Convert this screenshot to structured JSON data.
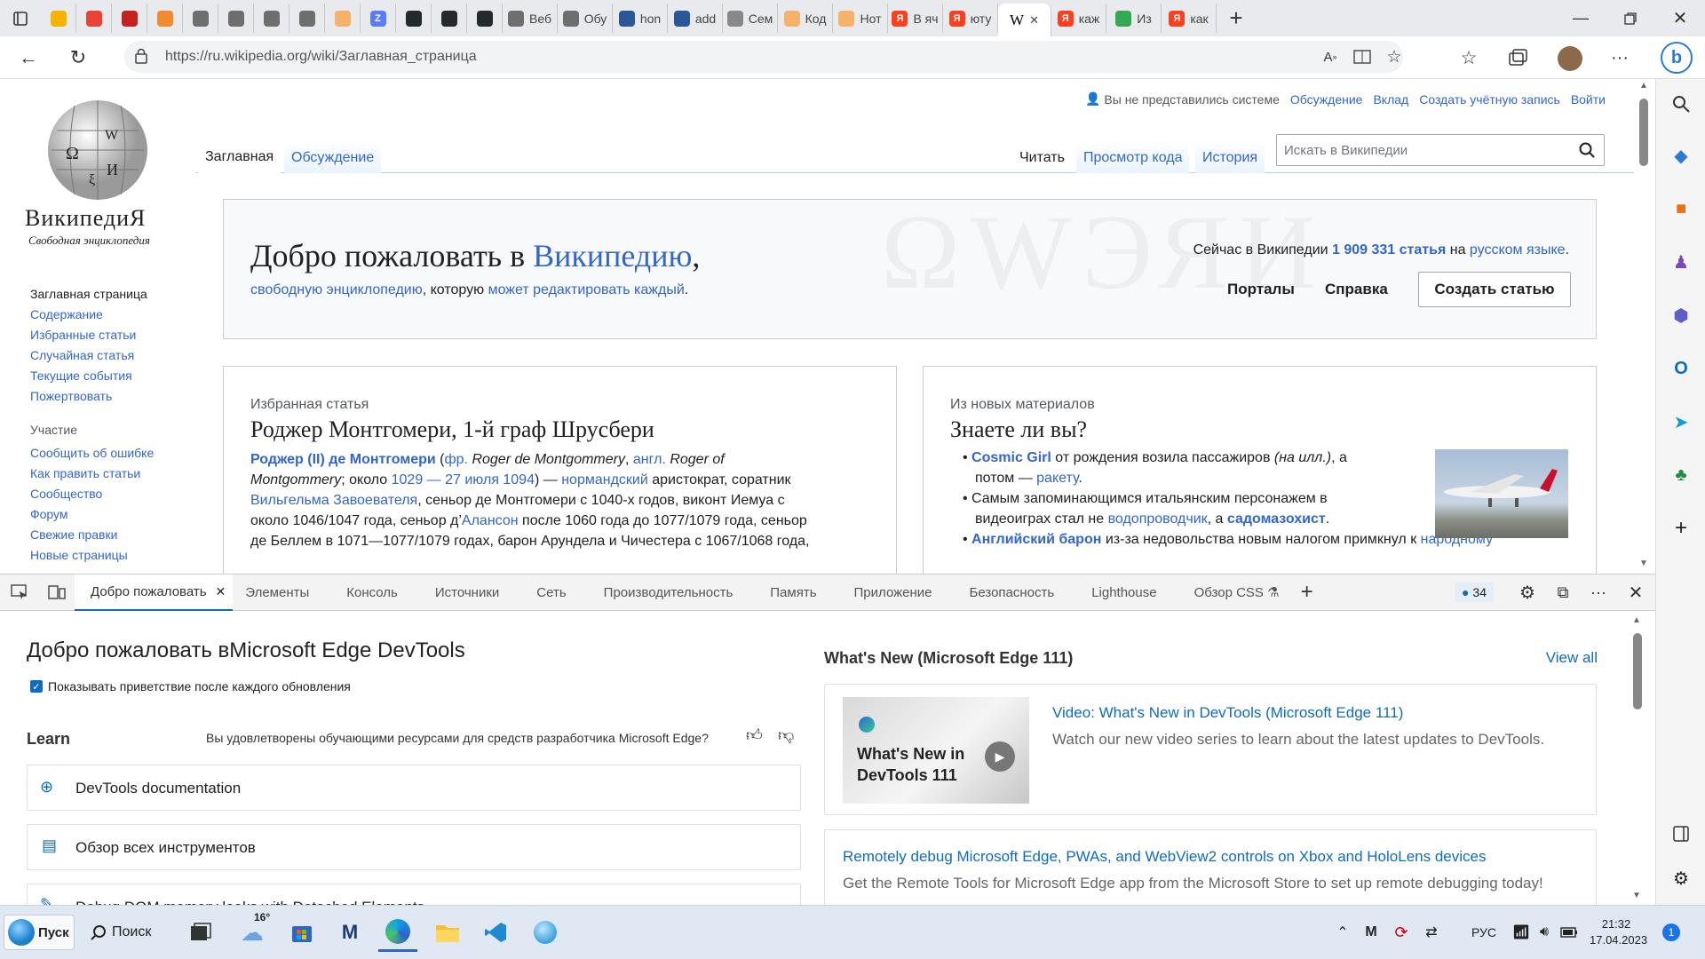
{
  "browser": {
    "tabs": [
      {
        "label": "",
        "icon": "copilot-icon",
        "color": "#f4b400"
      },
      {
        "label": "",
        "icon": "gmail-icon",
        "color": "#ea4335"
      },
      {
        "label": "",
        "icon": "gmail-icon",
        "color": "#c5221f"
      },
      {
        "label": "",
        "icon": "app-icon",
        "color": "#f28b30"
      },
      {
        "label": "",
        "icon": "chatgpt-icon",
        "color": "#6e6e6e"
      },
      {
        "label": "",
        "icon": "chatgpt-icon",
        "color": "#6e6e6e"
      },
      {
        "label": "",
        "icon": "chatgpt-icon",
        "color": "#6e6e6e"
      },
      {
        "label": "",
        "icon": "chatgpt-icon",
        "color": "#6e6e6e"
      },
      {
        "label": "",
        "icon": "link-icon",
        "color": "#f6b26b"
      },
      {
        "label": "",
        "icon": "z-icon",
        "color": "#5b7cfa"
      },
      {
        "label": "",
        "icon": "github-icon",
        "color": "#24292e"
      },
      {
        "label": "",
        "icon": "github-icon",
        "color": "#24292e"
      },
      {
        "label": "",
        "icon": "github-icon",
        "color": "#24292e"
      },
      {
        "label": "Веб",
        "icon": "chatgpt-icon",
        "color": "#6e6e6e"
      },
      {
        "label": "Обу",
        "icon": "chatgpt-icon",
        "color": "#6e6e6e"
      },
      {
        "label": "hon",
        "icon": "doc-icon",
        "color": "#2b579a"
      },
      {
        "label": "add",
        "icon": "doc-icon",
        "color": "#2b579a"
      },
      {
        "label": "Сем",
        "icon": "page-icon",
        "color": "#888888"
      },
      {
        "label": "Код",
        "icon": "link-icon",
        "color": "#f6b26b"
      },
      {
        "label": "Нот",
        "icon": "link-icon",
        "color": "#f6b26b"
      },
      {
        "label": "В яч",
        "icon": "yandex-icon",
        "color": "#fc3f1d"
      },
      {
        "label": "юту",
        "icon": "yandex-icon",
        "color": "#fc3f1d"
      },
      {
        "label": "W",
        "icon": "wikipedia-icon",
        "color": "#ffffff",
        "active": true
      },
      {
        "label": "каж",
        "icon": "yandex-icon",
        "color": "#fc3f1d"
      },
      {
        "label": "Из ",
        "icon": "bookmark-icon",
        "color": "#34a853"
      },
      {
        "label": "как",
        "icon": "yandex-icon",
        "color": "#fc3f1d"
      }
    ],
    "url": "https://ru.wikipedia.org/wiki/Заглавная_страница"
  },
  "wiki": {
    "logo_title": "ВикипедиЯ",
    "logo_subtitle": "Свободная энциклопедия",
    "nav": [
      "Заглавная страница",
      "Содержание",
      "Избранные статьи",
      "Случайная статья",
      "Текущие события",
      "Пожертвовать"
    ],
    "participation_heading": "Участие",
    "participation": [
      "Сообщить об ошибке",
      "Как править статьи",
      "Сообщество",
      "Форум",
      "Свежие правки",
      "Новые страницы"
    ],
    "personal": {
      "not_logged": "Вы не представились системе",
      "talk": "Обсуждение",
      "contrib": "Вклад",
      "create_account": "Создать учётную запись",
      "login": "Войти"
    },
    "tabs": {
      "main": "Заглавная",
      "discussion": "Обсуждение",
      "read": "Читать",
      "view_source": "Просмотр кода",
      "history": "История"
    },
    "search_placeholder": "Искать в Википедии",
    "welcome": {
      "prefix": "Добро пожаловать в ",
      "link": "Википедию",
      "suffix": ",",
      "line2_a": "свободную энциклопедию",
      "line2_b": ", которую ",
      "line2_c": "может редактировать каждый",
      "line2_d": ".",
      "stats_a": "Сейчас в Википедии ",
      "stats_count": "1 909 331 статья",
      "stats_b": " на ",
      "stats_lang": "русском языке",
      "stats_c": ".",
      "portals": "Порталы",
      "help": "Справка",
      "create": "Создать статью"
    },
    "featured": {
      "label": "Избранная статья",
      "title": "Роджер Монтгомери, 1-й граф Шрусбери",
      "l1_bold": "Роджер (II) де Монтгомери",
      "l1_a": " (",
      "l1_fr": "фр.",
      "l1_b": " ",
      "l1_fr_name": "Roger de Montgommery",
      "l1_c": ", ",
      "l1_en": "англ.",
      "l1_d": " ",
      "l1_en_name": "Roger of",
      "l2_en_name": "Montgommery",
      "l2_a": "; около ",
      "l2_y1": "1029",
      "l2_dash": " — ",
      "l2_y2": "27 июля 1094",
      "l2_b": ") — ",
      "l2_norm": "нормандский",
      "l2_c": " аристократ, соратник",
      "l3_link": "Вильгельма Завоевателя",
      "l3_rest": ", сеньор де Монтгомери с 1040-х годов, виконт Иемуа с",
      "l4_a": "около 1046/1047 года, сеньор д’",
      "l4_link": "Алансон",
      "l4_b": " после 1060 года до 1077/1079 года, сеньор",
      "l5": "де Беллем в 1071—1077/1079 годах, барон Арундела и Чичестера с 1067/1068 года,"
    },
    "dyk": {
      "label": "Из новых материалов",
      "title": "Знаете ли вы?",
      "i1_link": "Cosmic Girl",
      "i1_a": " от рождения возила пассажиров ",
      "i1_it": "(на илл.)",
      "i1_b": ", а",
      "i1_l2a": "потом — ",
      "i1_l2link": "ракету",
      "i1_l2b": ".",
      "i2_a": "Самым запоминающимся итальянским персонажем в",
      "i2_l2a": "видеоиграх стал не ",
      "i2_link1": "водопроводчик",
      "i2_l2b": ", а ",
      "i2_link2": "садомазохист",
      "i2_l2c": ".",
      "i3_link": "Английский барон",
      "i3_a": " из-за недовольства новым налогом примкнул к ",
      "i3_link2": "народному"
    }
  },
  "devtools": {
    "tabs": [
      "Добро пожаловать",
      "Элементы",
      "Консоль",
      "Источники",
      "Сеть",
      "Производительность",
      "Память",
      "Приложение",
      "Безопасность",
      "Lighthouse",
      "Обзор CSS"
    ],
    "issues_count": "34",
    "title": "Добро пожаловать вMicrosoft Edge DevTools",
    "checkbox_label": "Показывать приветствие после каждого обновления",
    "learn": "Learn",
    "feedback_q": "Вы удовлетворены обучающими ресурсами для средств разработчика Microsoft Edge?",
    "learn_items": [
      "DevTools documentation",
      "Обзор всех инструментов",
      "Debug DOM memory leaks with Detached Elements"
    ],
    "whats_new_heading": "What's New (Microsoft Edge 111)",
    "view_all": "View all",
    "thumb_text": "What's New in DevTools 111",
    "video_title": "Video: What's New in DevTools (Microsoft Edge 111)",
    "video_desc": "Watch our new video series to learn about the latest updates to DevTools.",
    "remote_title": "Remotely debug Microsoft Edge, PWAs, and WebView2 controls on Xbox and HoloLens devices",
    "remote_desc": "Get the Remote Tools for Microsoft Edge app from the Microsoft Store to set up remote debugging today!"
  },
  "taskbar": {
    "start": "Пуск",
    "search": "Поиск",
    "weather": "16°",
    "lang": "РУС",
    "time": "21:32",
    "date": "17.04.2023",
    "notifications": "1"
  }
}
